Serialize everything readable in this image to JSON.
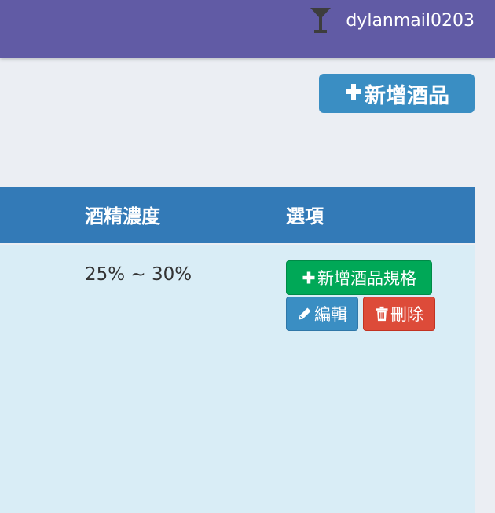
{
  "topbar": {
    "username": "dylanmail0203",
    "icon": "cocktail-glass-icon",
    "background": "#615ba5"
  },
  "toolbar": {
    "add_product_label": "新增酒品",
    "add_icon": "plus-icon",
    "button_color": "#3a8ec3"
  },
  "table": {
    "header_color": "#337ab7",
    "row_color": "#d9edf6",
    "columns": [
      "酒精濃度",
      "選項"
    ],
    "rows": [
      {
        "abv": "25% ~ 30%",
        "actions": {
          "add_spec_label": "新增酒品規格",
          "edit_label": "編輯",
          "delete_label": "刪除"
        }
      }
    ]
  },
  "colors": {
    "add_spec": "#00a857",
    "edit": "#3a8ec3",
    "delete": "#dd4b39"
  }
}
